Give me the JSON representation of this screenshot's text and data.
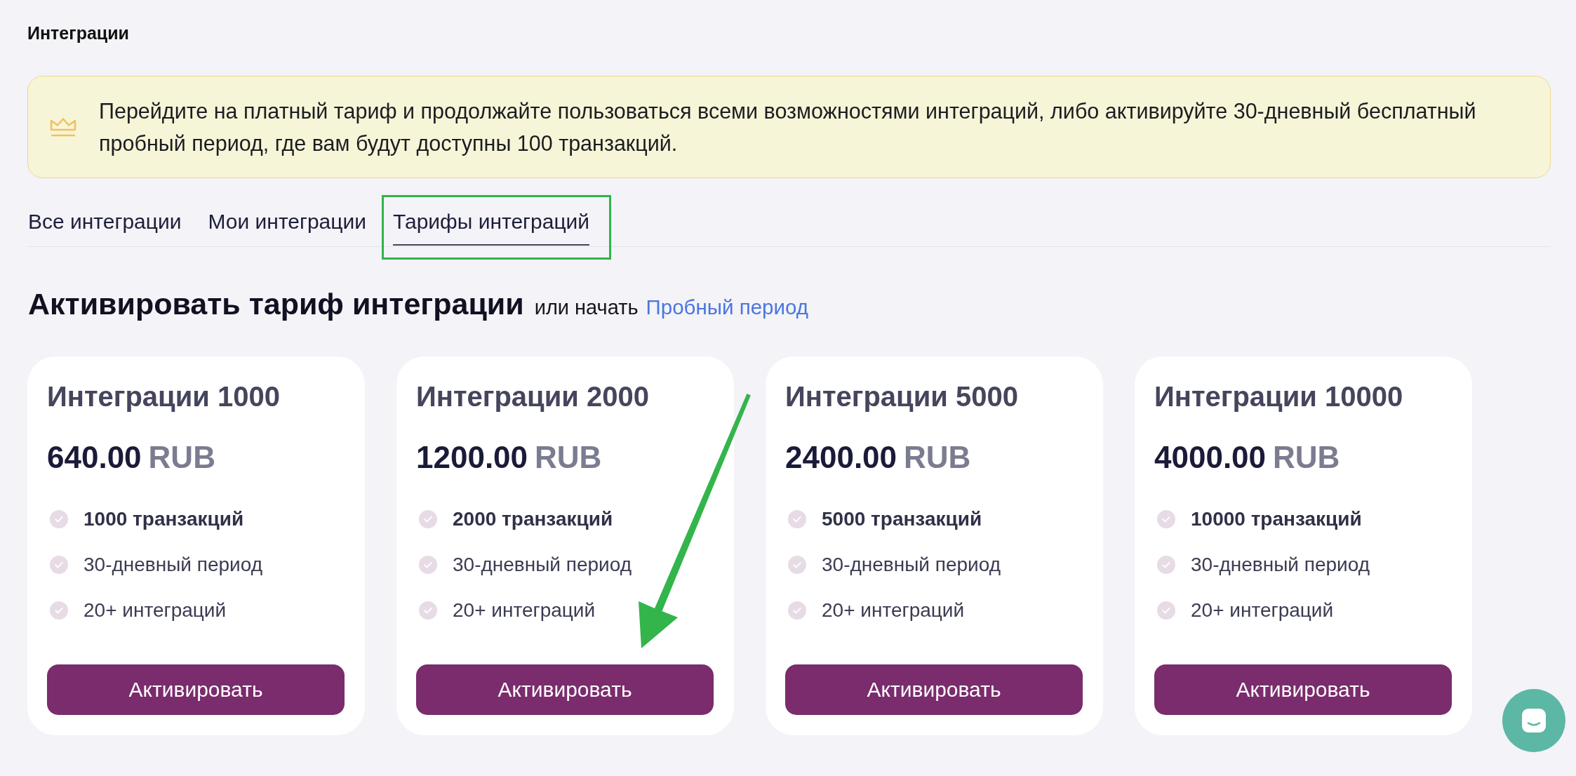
{
  "page": {
    "title": "Интеграции"
  },
  "banner": {
    "text": "Перейдите на платный тариф и продолжайте пользоваться всеми возможностями интеграций, либо активируйте 30-дневный бесплатный пробный период, где вам будут доступны 100 транзакций."
  },
  "tabs": [
    {
      "label": "Все интеграции",
      "selected": false
    },
    {
      "label": "Мои интеграции",
      "selected": false
    },
    {
      "label": "Тарифы интеграций",
      "selected": true
    }
  ],
  "section": {
    "heading": "Активировать тариф интеграции",
    "subtext": "или начать",
    "link": "Пробный период"
  },
  "plans": [
    {
      "name": "Интеграции 1000",
      "price": "640.00",
      "currency": "RUB",
      "features": [
        {
          "text": "1000 транзакций",
          "bold": true
        },
        {
          "text": "30-дневный период",
          "bold": false
        },
        {
          "text": "20+ интеграций",
          "bold": false
        }
      ],
      "button": "Активировать"
    },
    {
      "name": "Интеграции 2000",
      "price": "1200.00",
      "currency": "RUB",
      "features": [
        {
          "text": "2000 транзакций",
          "bold": true
        },
        {
          "text": "30-дневный период",
          "bold": false
        },
        {
          "text": "20+ интеграций",
          "bold": false
        }
      ],
      "button": "Активировать"
    },
    {
      "name": "Интеграции 5000",
      "price": "2400.00",
      "currency": "RUB",
      "features": [
        {
          "text": "5000 транзакций",
          "bold": true
        },
        {
          "text": "30-дневный период",
          "bold": false
        },
        {
          "text": "20+ интеграций",
          "bold": false
        }
      ],
      "button": "Активировать"
    },
    {
      "name": "Интеграции 10000",
      "price": "4000.00",
      "currency": "RUB",
      "features": [
        {
          "text": "10000 транзакций",
          "bold": true
        },
        {
          "text": "30-дневный период",
          "bold": false
        },
        {
          "text": "20+ интеграций",
          "bold": false
        }
      ],
      "button": "Активировать"
    }
  ]
}
